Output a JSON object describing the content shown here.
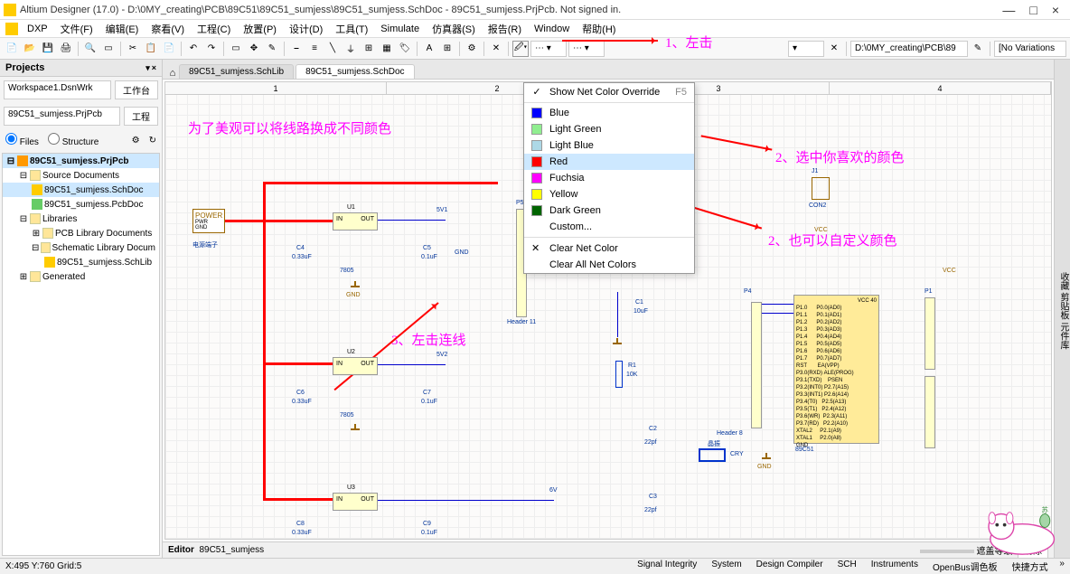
{
  "title": "Altium Designer (17.0) - D:\\0MY_creating\\PCB\\89C51\\89C51_sumjess\\89C51_sumjess.SchDoc - 89C51_sumjess.PrjPcb. Not signed in.",
  "menu": {
    "dxp": "DXP",
    "file": "文件(F)",
    "edit": "编辑(E)",
    "view": "察看(V)",
    "project": "工程(C)",
    "place": "放置(P)",
    "design": "设计(D)",
    "tools": "工具(T)",
    "sim": "Simulate",
    "simcn": "仿真器(S)",
    "report": "报告(R)",
    "window": "Window",
    "help": "帮助(H)"
  },
  "projects": {
    "title": "Projects",
    "workspace": "Workspace1.DsnWrk",
    "workspace_btn": "工作台",
    "project": "89C51_sumjess.PrjPcb",
    "project_btn": "工程",
    "radio_files": "Files",
    "radio_structure": "Structure",
    "tree": {
      "root": "89C51_sumjess.PrjPcb",
      "src": "Source Documents",
      "sch": "89C51_sumjess.SchDoc",
      "pcb": "89C51_sumjess.PcbDoc",
      "libs": "Libraries",
      "pcblib": "PCB Library Documents",
      "schlib": "Schematic Library Docum",
      "schlibfile": "89C51_sumjess.SchLib",
      "gen": "Generated"
    }
  },
  "tabs": {
    "t1": "89C51_sumjess.SchLib",
    "t2": "89C51_sumjess.SchDoc"
  },
  "ruler": {
    "c1": "1",
    "c2": "2",
    "c3": "3",
    "c4": "4"
  },
  "dropdown": {
    "header": "Show Net Color Override",
    "shortcut": "F5",
    "blue": "Blue",
    "lgreen": "Light Green",
    "lblue": "Light Blue",
    "red": "Red",
    "fuchsia": "Fuchsia",
    "yellow": "Yellow",
    "dgreen": "Dark Green",
    "custom": "Custom...",
    "clear": "Clear Net Color",
    "clearall": "Clear All Net Colors"
  },
  "annotations": {
    "a1": "1、左击",
    "a2": "为了美观可以将线路换成不同颜色",
    "a3": "2、选中你喜欢的颜色",
    "a4": "2、也可以自定义颜色",
    "a5": "3、左击连线"
  },
  "schematic": {
    "power_block": "POWER",
    "pwr": "PWR",
    "gnd_lbl": "GND",
    "ps_note": "电源端子",
    "c4": "C4",
    "c4v": "0.33uF",
    "c5": "C5",
    "c5v": "0.1uF",
    "u1": "7805",
    "u1ref": "U1",
    "in": "IN",
    "out": "OUT",
    "gnd": "GND",
    "c6": "C6",
    "c6v": "0.33uF",
    "c7": "C7",
    "c7v": "0.1uF",
    "u2": "7805",
    "u2ref": "U2",
    "c8": "C8",
    "c8v": "0.33uF",
    "c9": "C9",
    "c9v": "0.1uF",
    "u3": "7805",
    "u3ref": "U3",
    "fv1": "5V1",
    "fv2": "5V2",
    "fv3": "6V",
    "gnd2": "GND",
    "gnd3": "GND",
    "header": "Header 11",
    "p5": "P5",
    "r1": "R1",
    "r1v": "10K",
    "c1": "C1",
    "c1v": "10uF",
    "c2": "C2",
    "c2v": "22pf",
    "c3": "C3",
    "c3v": "22pf",
    "cry": "CRY",
    "cry_note": "晶振",
    "p4": "P4",
    "header8": "Header 8",
    "mcu": "89C51",
    "p1": "P1",
    "vcc": "VCC",
    "con2": "CON2",
    "j1": "J1"
  },
  "editor_footer": {
    "tab": "Editor",
    "name": "89C51_sumjess",
    "cover": "遮盖等级",
    "clear": "清除"
  },
  "status": {
    "pos": "X:495 Y:760  Grid:5",
    "tabs": {
      "si": "Signal Integrity",
      "sys": "System",
      "dc": "Design Compiler",
      "sch": "SCH",
      "inst": "Instruments",
      "ob": "OpenBus调色板",
      "sc": "快捷方式"
    }
  },
  "toolbar_combo": {
    "path": "D:\\0MY_creating\\PCB\\89",
    "variations": "[No Variations"
  }
}
